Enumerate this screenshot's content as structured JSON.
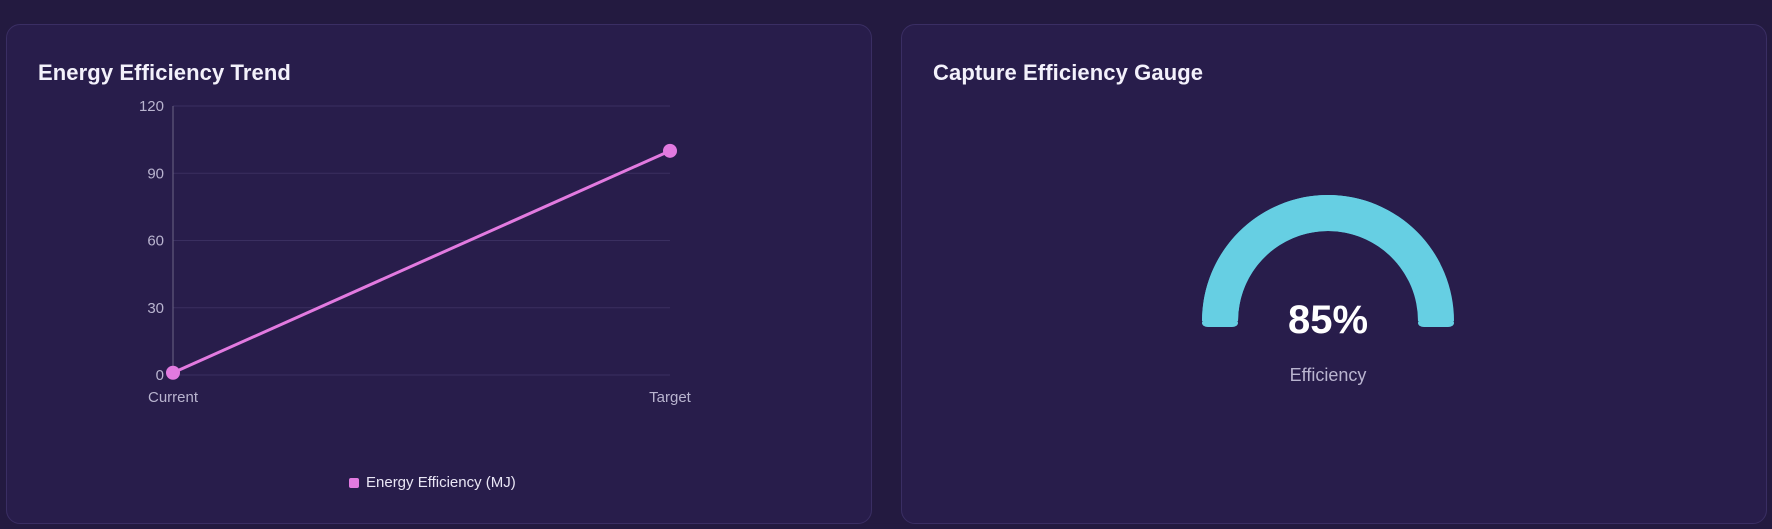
{
  "colors": {
    "series": "#e27ae0",
    "gauge": "#66cfe3",
    "gauge_track": "#3a2e63"
  },
  "left_card": {
    "title": "Energy Efficiency Trend"
  },
  "right_card": {
    "title": "Capture Efficiency Gauge"
  },
  "chart_data": [
    {
      "type": "line",
      "title": "Energy Efficiency Trend",
      "categories": [
        "Current",
        "Target"
      ],
      "series": [
        {
          "name": "Energy Efficiency (MJ)",
          "values": [
            1,
            100
          ]
        }
      ],
      "ylim": [
        0,
        120
      ],
      "yticks": [
        0,
        30,
        60,
        90,
        120
      ],
      "grid": true,
      "legend": "bottom-center"
    },
    {
      "type": "gauge",
      "title": "Capture Efficiency Gauge",
      "value": 85,
      "value_label": "85%",
      "label": "Efficiency",
      "range": [
        0,
        100
      ]
    }
  ]
}
